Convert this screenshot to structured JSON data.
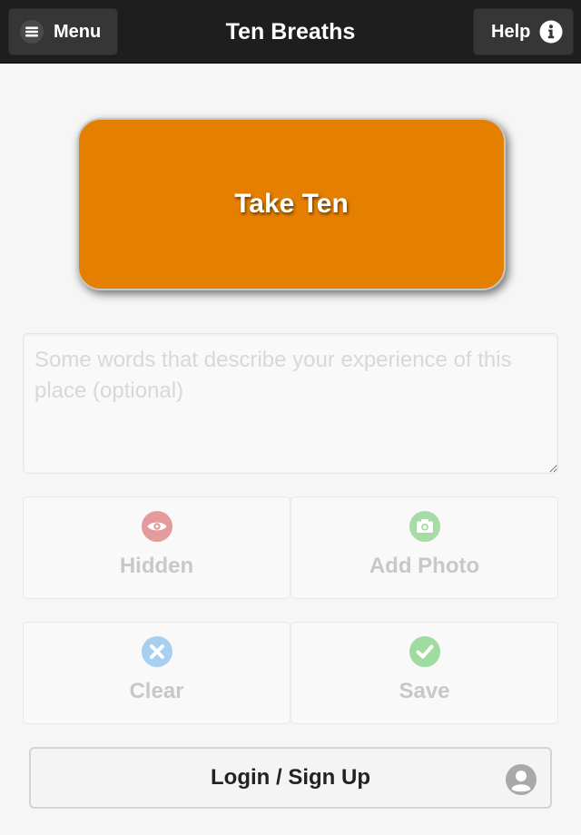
{
  "header": {
    "menu_label": "Menu",
    "menu_icon": "hamburger-icon",
    "title": "Ten Breaths",
    "help_label": "Help",
    "help_icon": "info-icon"
  },
  "main": {
    "take_ten_label": "Take Ten",
    "notes_placeholder": "Some words that describe your experience of this place (optional)",
    "notes_value": "",
    "actions": [
      {
        "label": "Hidden",
        "icon": "eye-icon",
        "color": "#e39b9b"
      },
      {
        "label": "Add Photo",
        "icon": "camera-icon",
        "color": "#a6dca6"
      },
      {
        "label": "Clear",
        "icon": "close-icon",
        "color": "#a8cff0"
      },
      {
        "label": "Save",
        "icon": "check-icon",
        "color": "#9fdca0"
      }
    ],
    "login_label": "Login / Sign Up",
    "login_icon": "user-icon"
  },
  "colors": {
    "header_bg": "#1e1e1e",
    "accent": "#e57f00",
    "page_bg": "#f6f6f6"
  }
}
